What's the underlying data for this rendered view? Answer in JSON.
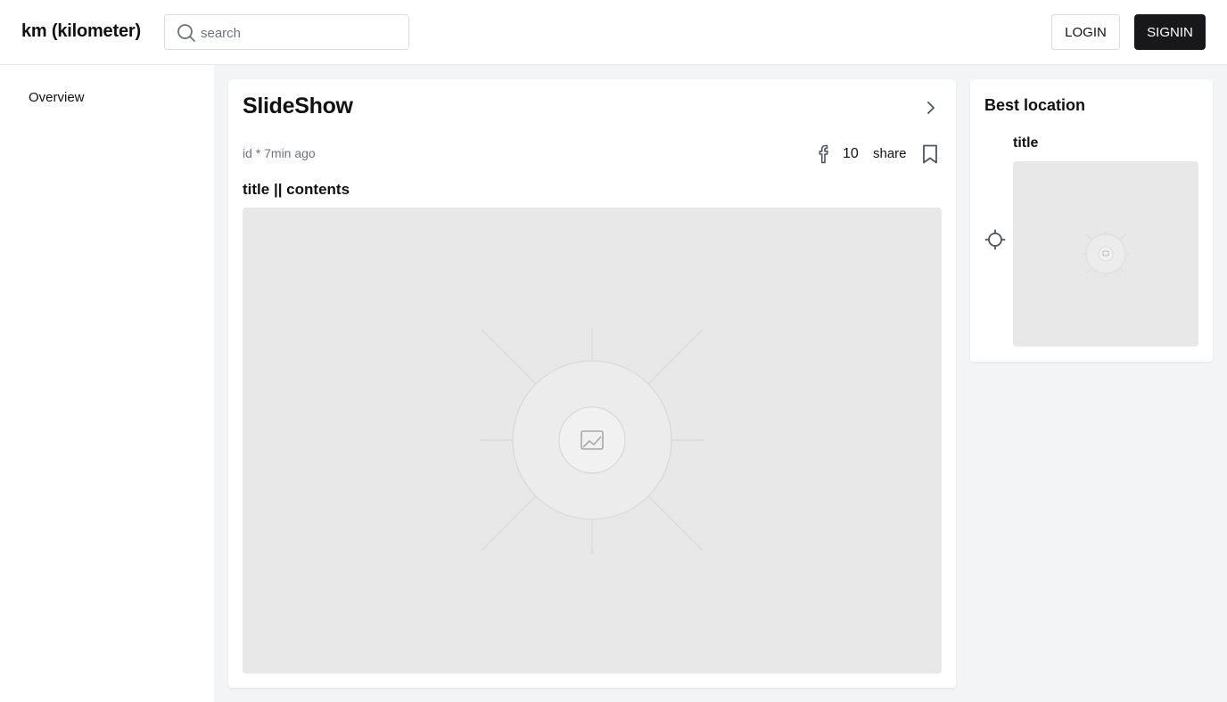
{
  "header": {
    "brand": "km (kilometer)",
    "search_placeholder": "search",
    "login_label": "LOGIN",
    "signin_label": "SIGNIN"
  },
  "sidebar": {
    "items": [
      {
        "label": "Overview",
        "icon": ""
      }
    ]
  },
  "post": {
    "title": "SlideShow",
    "meta": "id * 7min ago",
    "count": "10",
    "share_label": "share",
    "subtitle": "title || contents",
    "icons": [
      "chevron-right-icon",
      "facebook-icon",
      "bookmark-icon",
      "image-placeholder-icon"
    ]
  },
  "best_location": {
    "heading": "Best location",
    "item_title": "title",
    "icons": [
      "crosshair-icon",
      "image-placeholder-icon"
    ]
  },
  "colors": {
    "primary_button": "#18181b",
    "page_background": "#f3f4f6",
    "placeholder_gray": "#e8e8e8",
    "muted_text": "#6b7280"
  }
}
